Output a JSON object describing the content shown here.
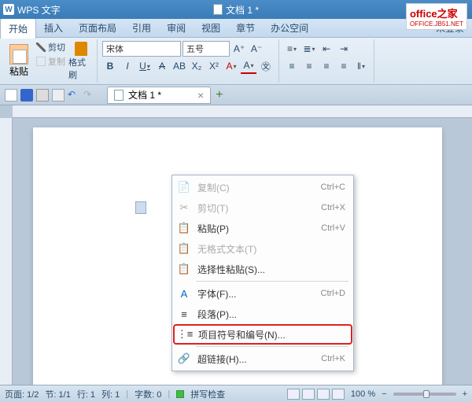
{
  "title": {
    "app": "WPS 文字",
    "doc": "文档 1 *"
  },
  "watermark": {
    "main": "office之家",
    "sub": "OFFICE.JB51.NET"
  },
  "menu": {
    "items": [
      "开始",
      "插入",
      "页面布局",
      "引用",
      "审阅",
      "视图",
      "章节",
      "办公空间"
    ],
    "right": "未登录"
  },
  "ribbon": {
    "paste": "粘贴",
    "cut": "剪切",
    "copy": "复制",
    "format_painter": "格式刷",
    "font_name": "宋体",
    "font_size": "五号"
  },
  "doctab": {
    "name": "文档 1 *"
  },
  "context_menu": [
    {
      "icon": "copy",
      "label": "复制(C)",
      "shortcut": "Ctrl+C",
      "disabled": true
    },
    {
      "icon": "cut",
      "label": "剪切(T)",
      "shortcut": "Ctrl+X",
      "disabled": true
    },
    {
      "icon": "paste",
      "label": "粘贴(P)",
      "shortcut": "Ctrl+V"
    },
    {
      "icon": "paste-plain",
      "label": "无格式文本(T)",
      "disabled": true
    },
    {
      "icon": "paste-special",
      "label": "选择性粘贴(S)..."
    },
    {
      "sep": true
    },
    {
      "icon": "font",
      "label": "字体(F)...",
      "shortcut": "Ctrl+D"
    },
    {
      "icon": "para",
      "label": "段落(P)..."
    },
    {
      "icon": "list",
      "label": "项目符号和编号(N)...",
      "highlight": true
    },
    {
      "sep": true
    },
    {
      "icon": "link",
      "label": "超链接(H)...",
      "shortcut": "Ctrl+K"
    }
  ],
  "status": {
    "page": "页面: 1/2",
    "section": "节: 1/1",
    "line": "行: 1",
    "col": "列: 1",
    "words": "字数: 0",
    "spell": "拼写检查",
    "zoom": "100 %"
  }
}
